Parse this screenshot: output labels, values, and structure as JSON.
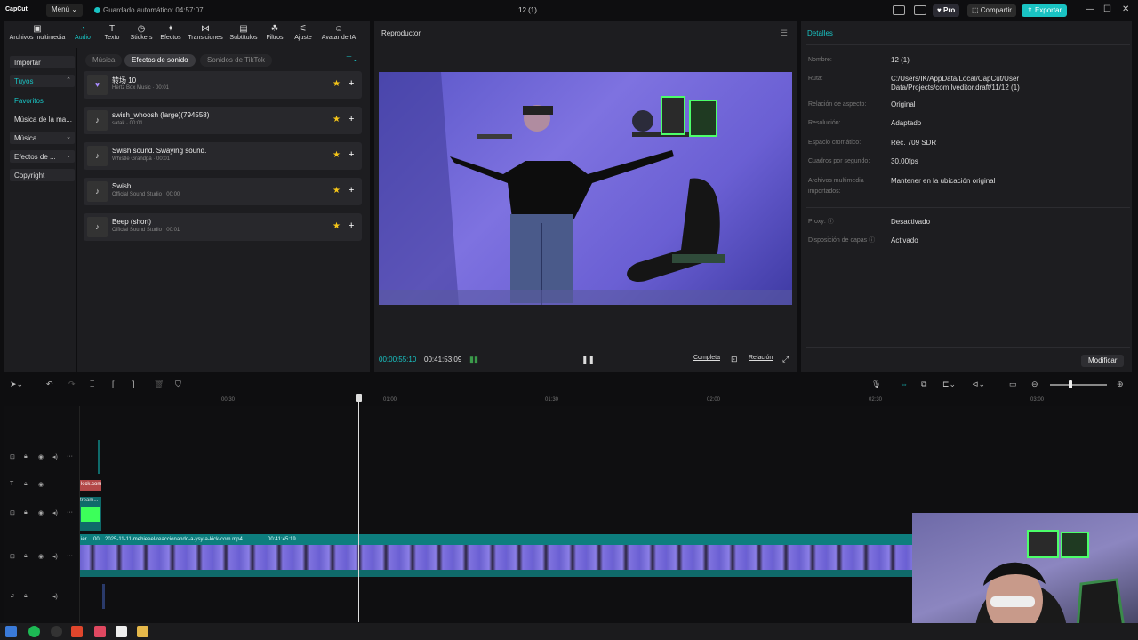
{
  "app": {
    "logo": "CapCut",
    "menu": "Menú",
    "autosave": "Guardado automático: 04:57:07",
    "project_title": "12 (1)",
    "pro": "Pro",
    "share": "Compartir",
    "export": "Exportar"
  },
  "toptabs": [
    {
      "label": "Archivos multimedia",
      "icon": "media-icon"
    },
    {
      "label": "Audio",
      "icon": "audio-icon"
    },
    {
      "label": "Texto",
      "icon": "text-icon"
    },
    {
      "label": "Stickers",
      "icon": "sticker-icon"
    },
    {
      "label": "Efectos",
      "icon": "effects-icon"
    },
    {
      "label": "Transiciones",
      "icon": "transition-icon"
    },
    {
      "label": "Subtítulos",
      "icon": "subtitle-icon"
    },
    {
      "label": "Filtros",
      "icon": "filter-icon"
    },
    {
      "label": "Ajuste",
      "icon": "adjust-icon"
    },
    {
      "label": "Avatar de IA",
      "icon": "avatar-icon"
    }
  ],
  "leftnav": {
    "importar": "Importar",
    "tuyos": "Tuyos",
    "favoritos": "Favoritos",
    "musica_mas": "Música de la ma...",
    "musica": "Música",
    "efectos": "Efectos de ...",
    "copyright": "Copyright"
  },
  "subtabs": {
    "musica": "Música",
    "efectos": "Efectos de sonido",
    "tiktok": "Sonidos de TikTok"
  },
  "sounds": [
    {
      "title": "转场 10",
      "sub": "Hertz Box Music · 00:01"
    },
    {
      "title": "swish_whoosh (large)(794558)",
      "sub": "satak · 00:01"
    },
    {
      "title": "Swish sound. Swaying sound.",
      "sub": "Whistle Grandpa · 00:01"
    },
    {
      "title": "Swish",
      "sub": "Official Sound Studio · 00:00"
    },
    {
      "title": "Beep (short)",
      "sub": "Official Sound Studio · 00:01"
    }
  ],
  "player": {
    "title": "Reproductor",
    "time_current": "00:00:55:10",
    "time_total": "00:41:53:09",
    "completa": "Completa",
    "relacion": "Relación"
  },
  "details": {
    "title": "Detalles",
    "rows": [
      {
        "label": "Nombre:",
        "value": "12 (1)"
      },
      {
        "label": "Ruta:",
        "value": "C:/Users/IK/AppData/Local/CapCut/User Data/Projects/com.lveditor.draft/11/12 (1)"
      },
      {
        "label": "Relación de aspecto:",
        "value": "Original"
      },
      {
        "label": "Resolución:",
        "value": "Adaptado"
      },
      {
        "label": "Espacio cromático:",
        "value": "Rec. 709 SDR"
      },
      {
        "label": "Cuadros por segundo:",
        "value": "30.00fps"
      },
      {
        "label": "Archivos multimedia importados:",
        "value": "Mantener en la ubicación original"
      },
      {
        "label": "Proxy:",
        "value": "Desactivado"
      },
      {
        "label": "Disposición de capas",
        "value": "Activado"
      }
    ],
    "modify": "Modificar"
  },
  "ruler": [
    "00:30",
    "01:00",
    "01:30",
    "02:00",
    "02:30",
    "03:00"
  ],
  "clips": {
    "text_clip": "kick.com",
    "sticker_clip": "tream...",
    "main_clip_label": "2025-11-11-mehieeel-reaccionando-a-ysy-a-kick-com.mp4",
    "main_clip_duration": "00:41:45:19",
    "main_clip_prefix": "ier",
    "main_clip_short": "00"
  },
  "colors": {
    "accent": "#19c3c3",
    "panel": "#1d1d20",
    "background": "#0e0e10",
    "star": "#f5c518"
  }
}
